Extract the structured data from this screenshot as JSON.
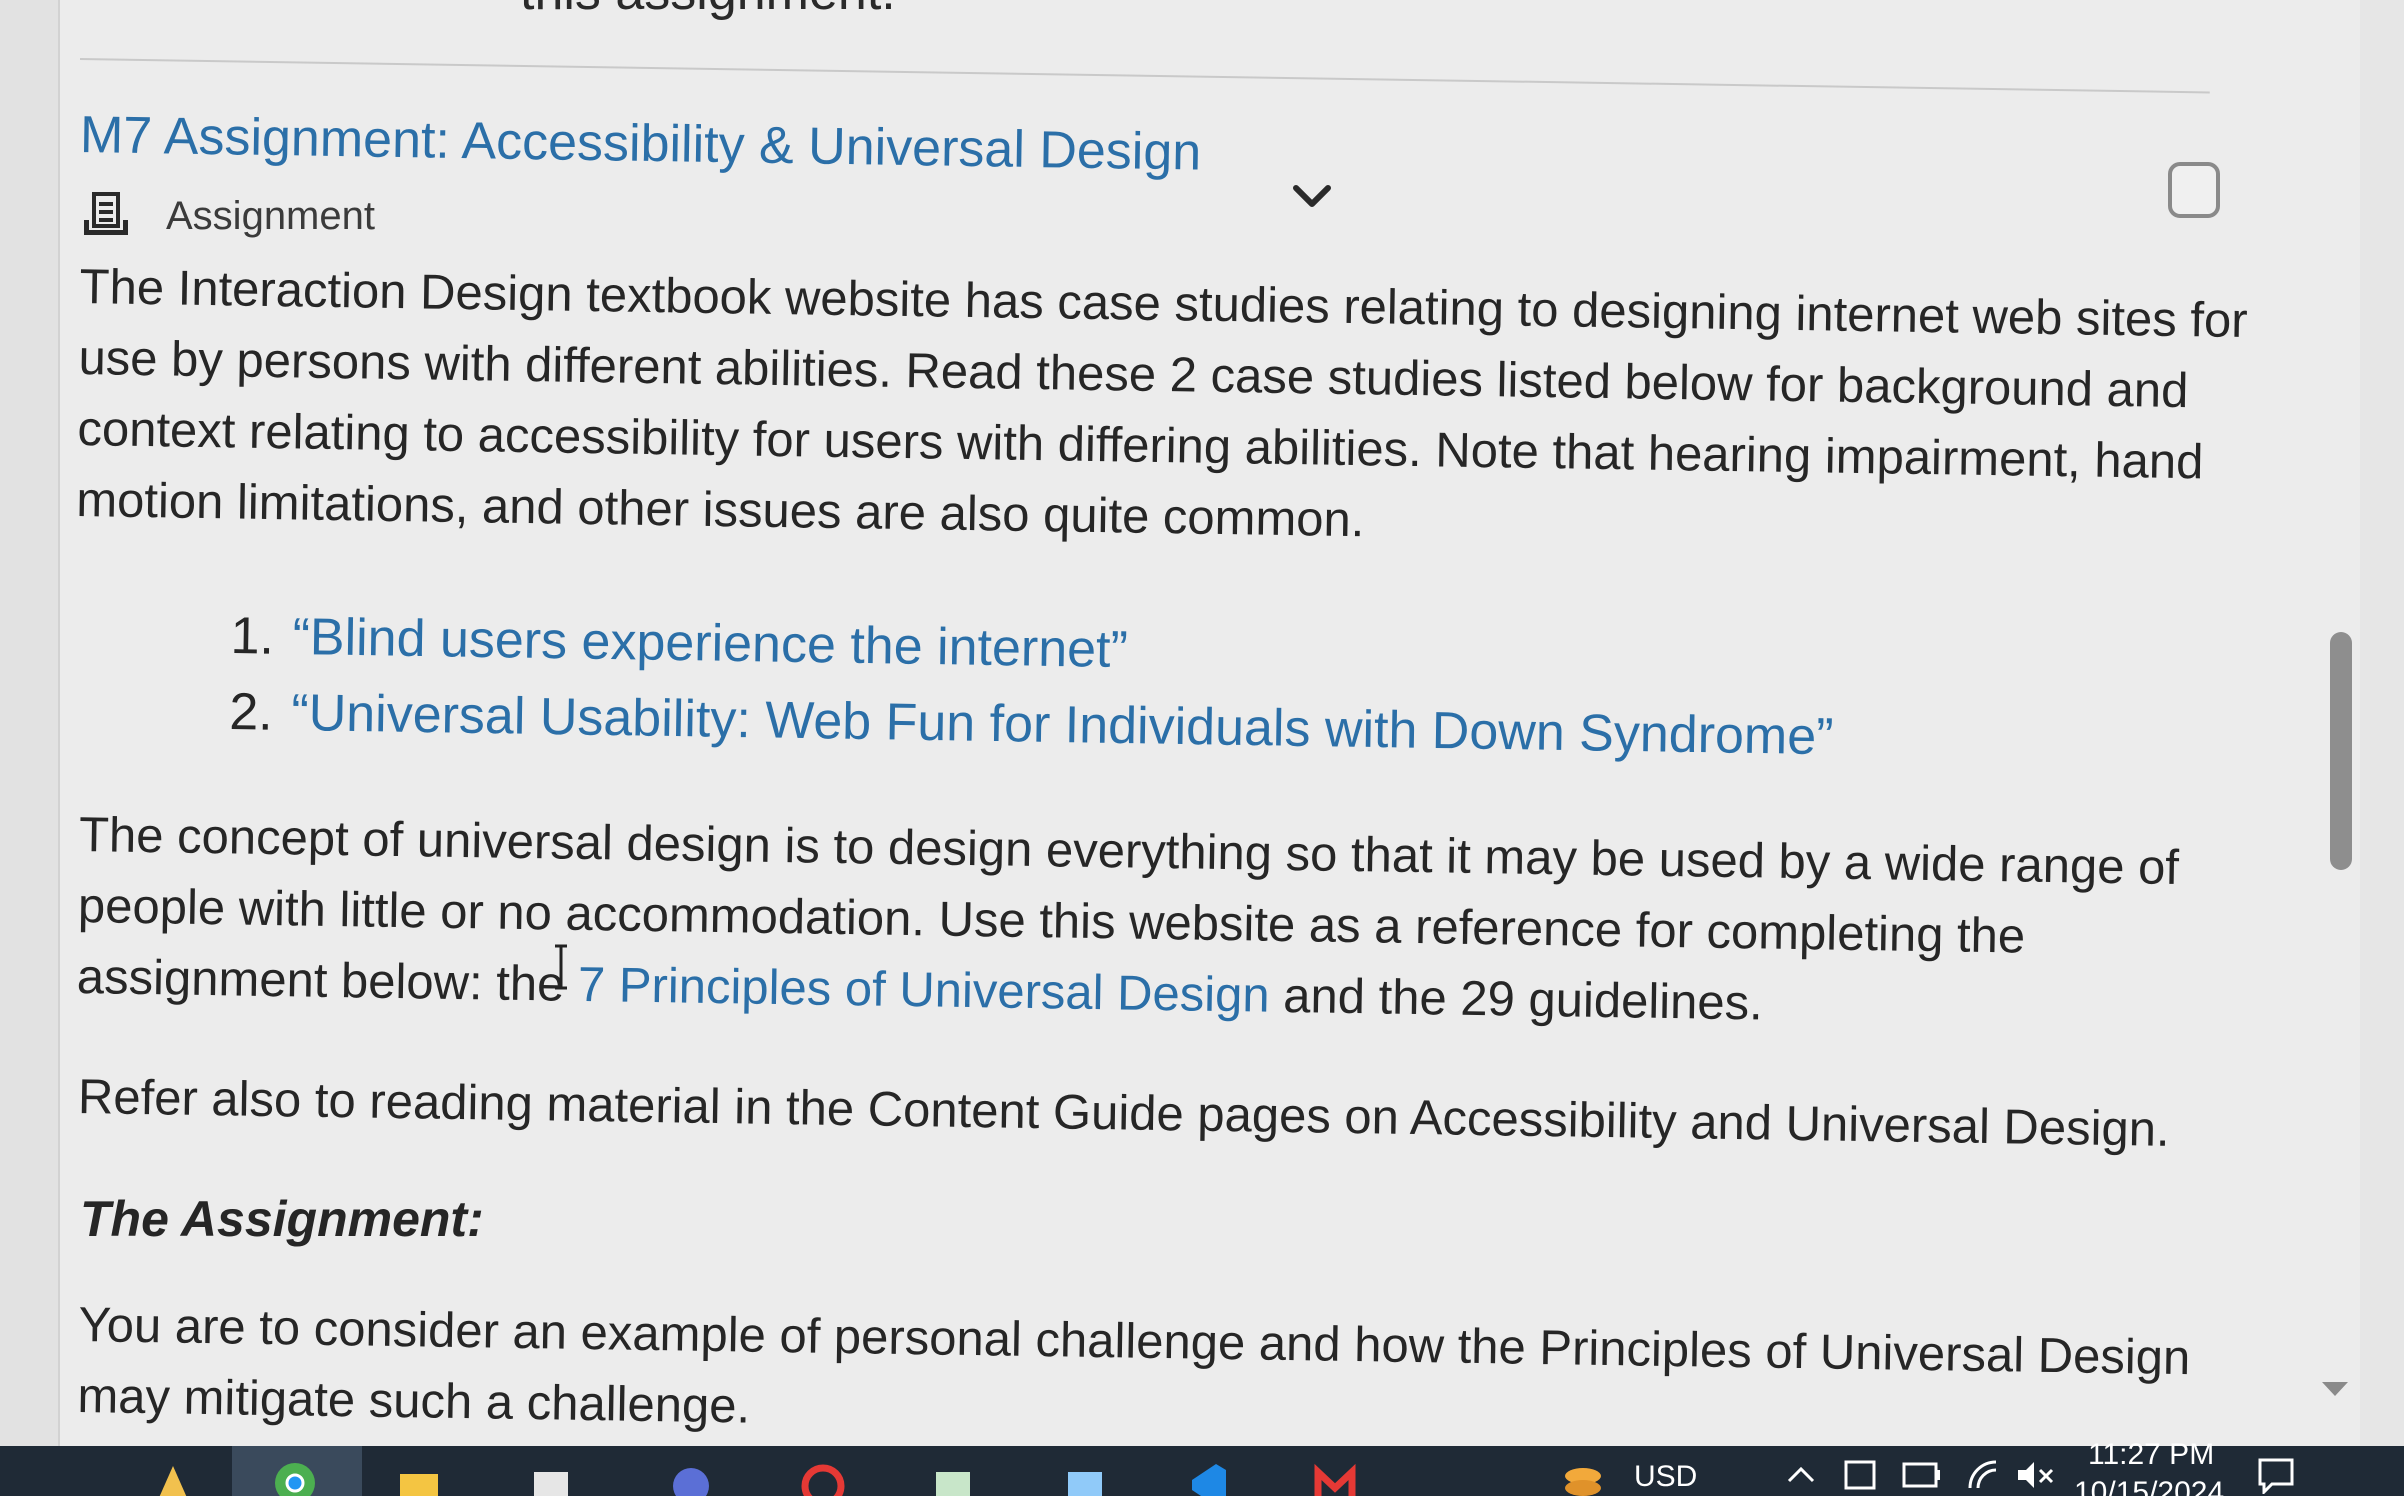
{
  "page": {
    "cutoff_text": "this assignment."
  },
  "item": {
    "title": "M7 Assignment: Accessibility & Universal Design",
    "type_label": "Assignment",
    "type_icon": "assignment-icon",
    "expand_icon": "chevron-down-icon"
  },
  "content": {
    "para1": "The Interaction Design textbook website has case studies relating to designing internet web sites for use by persons with different abilities. Read these 2 case studies listed below for background and context relating to accessibility for users with differing abilities. Note that hearing impairment, hand motion limitations, and other issues are also quite common.",
    "case_studies": [
      {
        "num": "1.",
        "label": "“Blind users experience the internet”"
      },
      {
        "num": "2.",
        "label": "“Universal Usability: Web Fun for Individuals with Down Syndrome”"
      }
    ],
    "para2_before": "The concept of universal design is to design everything so that it may be used by a wide range of people with little or no accommodation. Use this website as a reference for completing the assignment below: the",
    "para2_link": "7 Principles of Universal Design",
    "para2_after": "and the 29 guidelines.",
    "para3": "Refer also to reading material in the Content Guide pages on Accessibility and Universal Design.",
    "heading": "The Assignment:",
    "para4": "You are to consider an example of personal challenge and how the Principles of Universal Design may mitigate such a challenge."
  },
  "taskbar": {
    "currency": "USD",
    "time": "11:27 PM",
    "date": "10/15/2024",
    "icons": [
      "start-icon",
      "chrome-icon",
      "file-explorer-icon",
      "store-icon",
      "browser-icon",
      "opera-icon",
      "paint-icon",
      "word-icon",
      "vscode-icon",
      "gmail-icon",
      "coins-icon",
      "chevron-up-icon",
      "network-icon",
      "battery-icon",
      "wifi-icon",
      "volume-muted-icon",
      "notification-icon"
    ]
  },
  "colors": {
    "link": "#2b6fa8",
    "text": "#262626",
    "taskbar": "#1f2a36"
  }
}
